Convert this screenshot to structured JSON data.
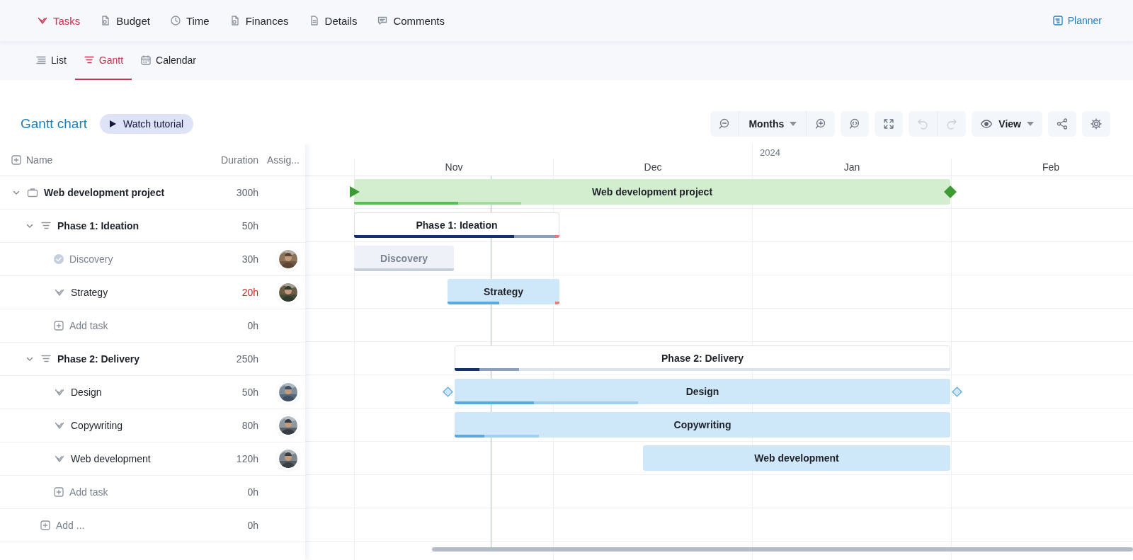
{
  "top_tabs": [
    {
      "label": "Tasks",
      "selected": true
    },
    {
      "label": "Budget",
      "selected": false
    },
    {
      "label": "Time",
      "selected": false
    },
    {
      "label": "Finances",
      "selected": false
    },
    {
      "label": "Details",
      "selected": false
    },
    {
      "label": "Comments",
      "selected": false
    }
  ],
  "planner_link": {
    "label": "Planner"
  },
  "view_tabs": [
    {
      "label": "List",
      "selected": false
    },
    {
      "label": "Gantt",
      "selected": true
    },
    {
      "label": "Calendar",
      "selected": false
    }
  ],
  "gantt": {
    "title": "Gantt chart",
    "tutorial_button": "Watch tutorial",
    "toolbar_groups": [
      {
        "buttons": [
          {
            "kind": "zoom-out",
            "disabled": false
          },
          {
            "kind": "dropdown",
            "label": "Months",
            "disabled": false
          },
          {
            "kind": "zoom-in",
            "disabled": false
          }
        ]
      },
      {
        "buttons": [
          {
            "kind": "fit",
            "disabled": false
          }
        ]
      },
      {
        "buttons": [
          {
            "kind": "fullscreen",
            "disabled": false
          }
        ]
      },
      {
        "buttons": [
          {
            "kind": "undo",
            "disabled": true
          },
          {
            "kind": "redo",
            "disabled": true
          }
        ]
      },
      {
        "buttons": [
          {
            "kind": "view",
            "label": "View",
            "disabled": false
          }
        ]
      },
      {
        "buttons": [
          {
            "kind": "share",
            "disabled": false
          }
        ]
      },
      {
        "buttons": [
          {
            "kind": "settings",
            "disabled": false
          }
        ]
      }
    ],
    "columns": [
      {
        "label": "Name"
      },
      {
        "label": "Duration"
      },
      {
        "label": "Assig..."
      }
    ],
    "months": [
      {
        "label": "Nov"
      },
      {
        "label": "Dec"
      },
      {
        "label": "Jan",
        "year": "2024"
      },
      {
        "label": "Feb"
      }
    ],
    "rows": [
      {
        "kind": "project",
        "name": "Web development project",
        "duration": "300h",
        "expanded": true,
        "bar": {
          "kind": "project",
          "label": "Web development project",
          "progress": {
            "level": 0.175
          },
          "expected": {
            "level": 0.28
          }
        },
        "children": [
          {
            "kind": "phase",
            "name": "Phase 1: Ideation",
            "duration": "50h",
            "expanded": true,
            "bar": {
              "kind": "phase",
              "label": "Phase 1: Ideation",
              "progress": {
                "level": 0.78
              },
              "expected": {
                "level": 0.98
              },
              "overdue": true
            },
            "children": [
              {
                "kind": "task",
                "name": "Discovery",
                "duration": "30h",
                "done": true,
                "overdue": false,
                "bar": {
                  "kind": "task",
                  "label": "Discovery",
                  "progress": {
                    "level": 1
                  }
                }
              },
              {
                "kind": "task",
                "name": "Strategy",
                "duration": "20h",
                "done": false,
                "overdue": true,
                "bar": {
                  "kind": "task",
                  "label": "Strategy",
                  "progress": {
                    "level": 0.46
                  },
                  "overdue": true
                }
              },
              {
                "kind": "add",
                "name": "Add task",
                "duration": "0h"
              }
            ]
          },
          {
            "kind": "phase",
            "name": "Phase 2: Delivery",
            "duration": "250h",
            "expanded": true,
            "bar": {
              "kind": "phase",
              "label": "Phase 2: Delivery",
              "progress": {
                "level": 0.05
              },
              "expected": {
                "level": 0.13
              }
            },
            "children": [
              {
                "kind": "task",
                "name": "Design",
                "duration": "50h",
                "done": false,
                "overdue": false,
                "bar": {
                  "kind": "task",
                  "label": "Design",
                  "progress": {
                    "level": 0.16
                  },
                  "expected": {
                    "level": 0.37
                  },
                  "handles": true
                }
              },
              {
                "kind": "task",
                "name": "Copywriting",
                "duration": "80h",
                "done": false,
                "overdue": false,
                "bar": {
                  "kind": "task",
                  "label": "Copywriting",
                  "progress": {
                    "level": 0.06
                  },
                  "expected": {
                    "level": 0.17
                  }
                }
              },
              {
                "kind": "task",
                "name": "Web development",
                "duration": "120h",
                "done": false,
                "overdue": false,
                "bar": {
                  "kind": "task",
                  "label": "Web development"
                }
              },
              {
                "kind": "add",
                "name": "Add task",
                "duration": "0h"
              }
            ]
          },
          {
            "kind": "add",
            "name": "Add ...",
            "duration": "0h"
          }
        ]
      }
    ]
  }
}
